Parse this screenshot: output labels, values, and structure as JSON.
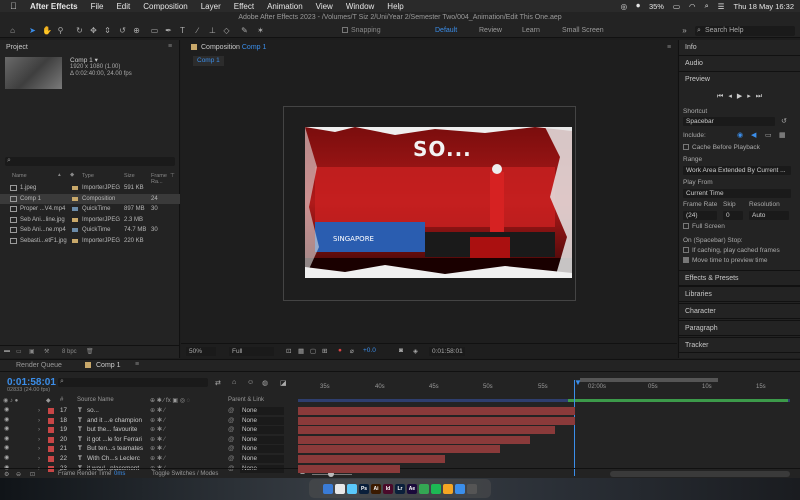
{
  "menubar": {
    "items": [
      "After Effects",
      "File",
      "Edit",
      "Composition",
      "Layer",
      "Effect",
      "Animation",
      "View",
      "Window",
      "Help"
    ],
    "battery": "35%",
    "datetime": "Thu 18 May  16:32"
  },
  "toolbar": {
    "doc_title": "Adobe After Effects 2023 - /Volumes/T Siz 2/Uni/Year 2/Semester Two/004_Animation/Edit This One.aep",
    "snapping": "Snapping",
    "workspaces": [
      "Default",
      "Review",
      "Learn",
      "Small Screen"
    ],
    "search_help": "Search Help"
  },
  "project": {
    "title": "Project",
    "selected_name": "Comp 1 ▾",
    "selected_info1": "1920 x 1080 (1.00)",
    "selected_info2": "Δ 0:02:40:00, 24.00 fps",
    "columns": [
      "Name",
      "Type",
      "Size",
      "Frame Ra..."
    ],
    "rows": [
      {
        "name": "1.jpeg",
        "type": "ImporterJPEG",
        "size": "591 KB",
        "fr": "",
        "color": "#c8a86a"
      },
      {
        "name": "Comp 1",
        "type": "Composition",
        "size": "",
        "fr": "24",
        "color": "#c8a86a"
      },
      {
        "name": "Proper ...V4.mp4",
        "type": "QuickTime",
        "size": "897 MB",
        "fr": "30",
        "color": "#6a8aa8"
      },
      {
        "name": "Seb Ani...line.jpg",
        "type": "ImporterJPEG",
        "size": "2.3 MB",
        "fr": "",
        "color": "#c8a86a"
      },
      {
        "name": "Seb Ani...ne.mp4",
        "type": "QuickTime",
        "size": "74.7 MB",
        "fr": "30",
        "color": "#6a8aa8"
      },
      {
        "name": "Sebasti...etF1.jpg",
        "type": "ImporterJPEG",
        "size": "220 KB",
        "fr": "",
        "color": "#c8a86a"
      }
    ],
    "bpc": "8 bpc"
  },
  "composition": {
    "tab": "Composition",
    "tab_name": "Comp 1",
    "sub_tab": "Comp 1",
    "overlay_text": "SO...",
    "zoom": "50%",
    "quality": "Full",
    "exposure": "+0.0",
    "timecode": "0:01:58:01"
  },
  "right_panel": {
    "info": "Info",
    "audio": "Audio",
    "preview": "Preview",
    "shortcut_label": "Shortcut",
    "shortcut_value": "Spacebar",
    "include_label": "Include:",
    "cache_before": "Cache Before Playback",
    "range_label": "Range",
    "range_value": "Work Area Extended By Current ...",
    "play_from_label": "Play From",
    "play_from_value": "Current Time",
    "frame_rate_label": "Frame Rate",
    "skip_label": "Skip",
    "resolution_label": "Resolution",
    "frame_rate_value": "(24)",
    "skip_value": "0",
    "resolution_value": "Auto",
    "full_screen": "Full Screen",
    "on_stop_label": "On (Spacebar) Stop:",
    "if_caching": "If caching, play cached frames",
    "move_time": "Move time to preview time",
    "sections": [
      "Effects & Presets",
      "Libraries",
      "Character",
      "Paragraph",
      "Tracker"
    ]
  },
  "timeline": {
    "tab_render": "Render Queue",
    "tab_comp": "Comp 1",
    "current_time": "0:01:58:01",
    "fps_info": "02833 (24.00 fps)",
    "header_source": "Source Name",
    "header_parent": "Parent & Link",
    "header_num": "#",
    "ticks": [
      "35s",
      "40s",
      "45s",
      "50s",
      "55s",
      "02:00s",
      "05s",
      "10s",
      "15s"
    ],
    "layers": [
      {
        "num": "17",
        "name": "so...",
        "bar_end": 575
      },
      {
        "num": "18",
        "name": "and it ...e champion",
        "bar_end": 575
      },
      {
        "num": "19",
        "name": "but the... favourite",
        "bar_end": 555
      },
      {
        "num": "20",
        "name": "it got ...le for Ferrari",
        "bar_end": 530
      },
      {
        "num": "21",
        "name": "But ten...s teamates",
        "bar_end": 500
      },
      {
        "num": "22",
        "name": "With Ch...s Leclerc",
        "bar_end": 445
      },
      {
        "num": "23",
        "name": "it woul...placement",
        "bar_end": 400
      }
    ],
    "parent_value": "None",
    "frame_render": "Frame Render Time",
    "render_ms": "0ms",
    "toggle": "Toggle Switches / Modes"
  },
  "dock": {
    "apps": [
      {
        "label": "",
        "color": "#3a7bd5"
      },
      {
        "label": "",
        "color": "#e8e8e8"
      },
      {
        "label": "",
        "color": "#5ac8fa"
      },
      {
        "label": "Ps",
        "color": "#0a1f3a"
      },
      {
        "label": "Ai",
        "color": "#3a1a00"
      },
      {
        "label": "Id",
        "color": "#4a0a2a"
      },
      {
        "label": "Lr",
        "color": "#0a1f3a"
      },
      {
        "label": "Ae",
        "color": "#1a0a3a"
      },
      {
        "label": "",
        "color": "#34a853"
      },
      {
        "label": "",
        "color": "#1db954"
      },
      {
        "label": "",
        "color": "#f5a623"
      },
      {
        "label": "",
        "color": "#3b8eea"
      },
      {
        "label": "",
        "color": "#555555"
      }
    ]
  }
}
